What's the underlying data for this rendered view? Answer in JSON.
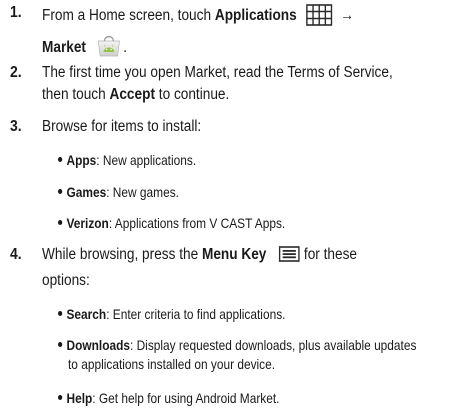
{
  "steps": [
    {
      "number": "1.",
      "line1_pre": "From a Home screen, touch ",
      "line1_bold": "Applications",
      "line1_arrow": "→",
      "line2_bold": "Market",
      "line2_post": "."
    },
    {
      "number": "2.",
      "line1": "The first time you open Market, read the Terms of Service,",
      "line2_pre": "then touch ",
      "line2_bold": "Accept",
      "line2_post": " to continue."
    },
    {
      "number": "3.",
      "line1": "Browse for items to install:",
      "bullets": [
        {
          "bold": "Apps",
          "text": ": New applications."
        },
        {
          "bold": "Games",
          "text": ": New games."
        },
        {
          "bold": "Verizon",
          "text": ": Applications from V CAST Apps."
        }
      ]
    },
    {
      "number": "4.",
      "line1_pre": "While browsing, press the ",
      "line1_bold": "Menu Key",
      "line1_post": " for these",
      "line2": "options:",
      "bullets": [
        {
          "bold": "Search",
          "text": ": Enter criteria to find applications."
        },
        {
          "bold": "Downloads",
          "text": ": Display requested downloads, plus available updates",
          "cont": "to applications installed on your device."
        },
        {
          "bold": "Help",
          "text": ": Get help for using Android Market."
        }
      ]
    }
  ],
  "icons": {
    "applications": "grid-icon",
    "market": "market-icon",
    "menu": "menu-key-icon"
  }
}
